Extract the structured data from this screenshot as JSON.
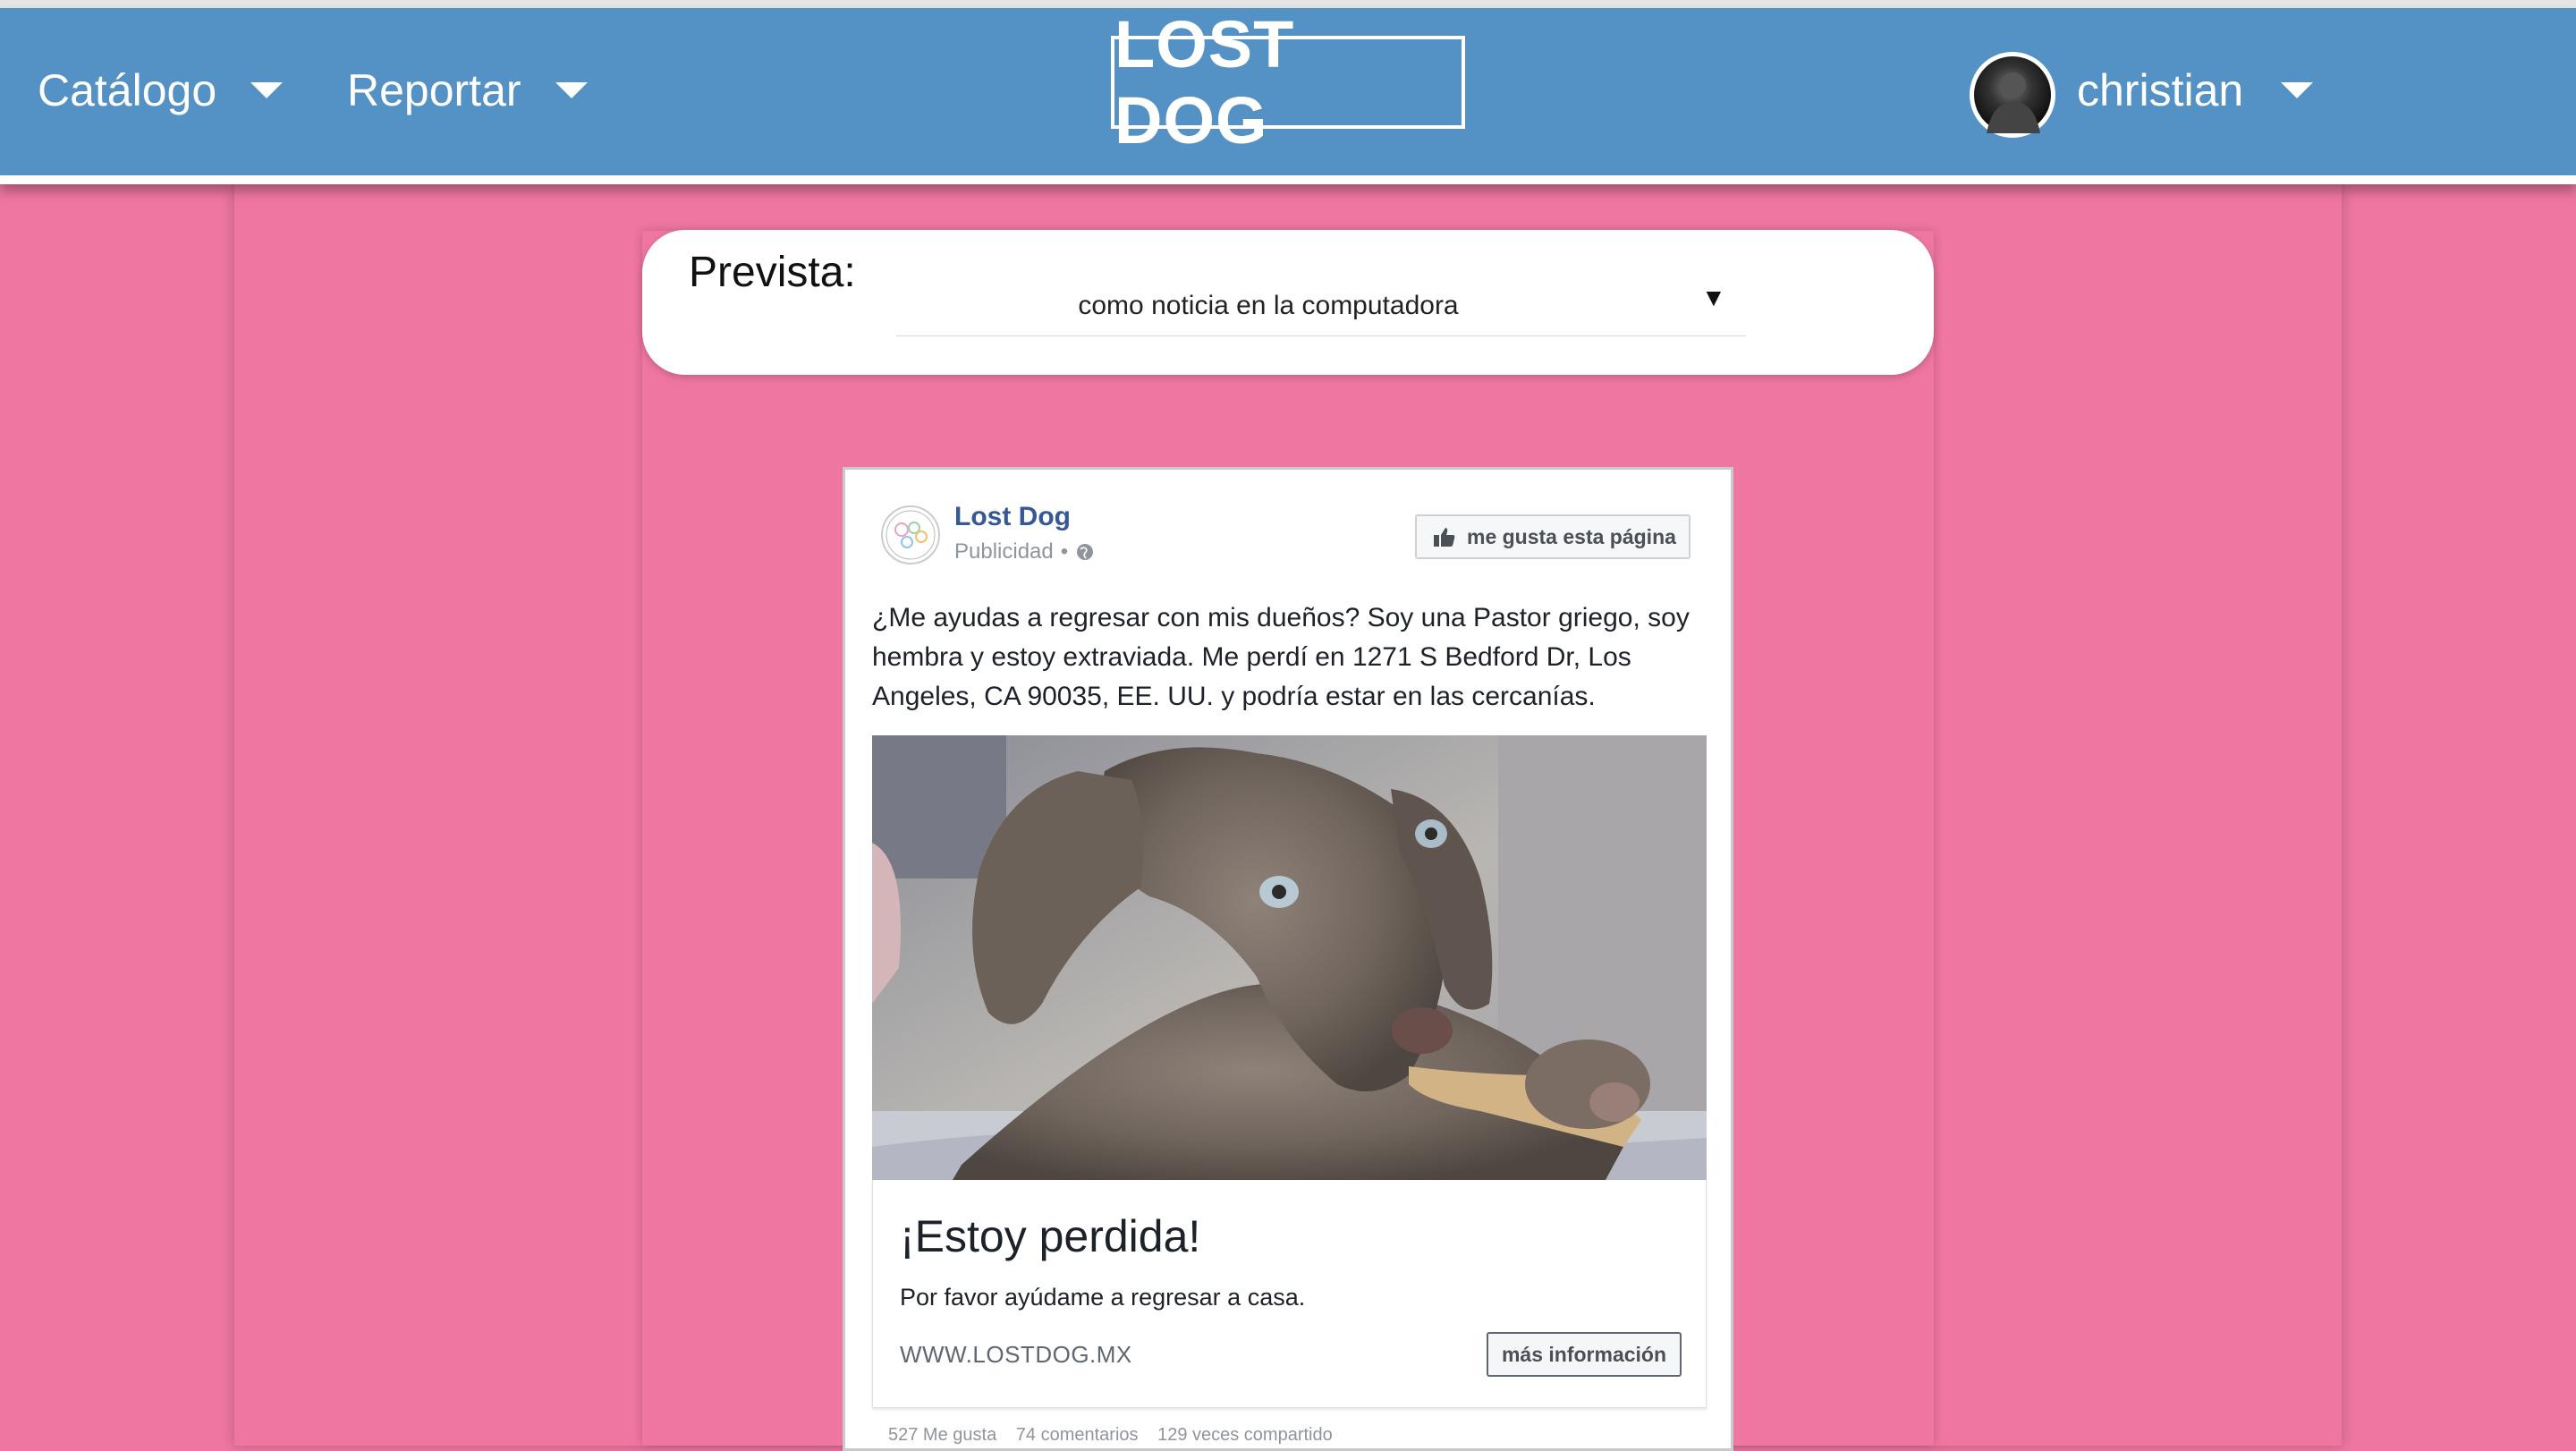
{
  "navbar": {
    "menu_catalog": "Catálogo",
    "menu_report": "Reportar",
    "logo": "LOST DOG",
    "user_name": "christian",
    "background_color": "#5491c5"
  },
  "page": {
    "background_color": "#ee76a0"
  },
  "preview": {
    "label": "Prevista:",
    "selected_option": "como noticia en la computadora",
    "arrow": "▼"
  },
  "ad": {
    "page_name": "Lost Dog",
    "sponsored": "Publicidad",
    "like_page_button": "me gusta esta página",
    "body_text": "¿Me ayudas a regresar con mis dueños? Soy una Pastor griego, soy hembra y estoy extraviada. Me perdí en 1271 S Bedford Dr, Los Angeles, CA 90035, EE. UU. y podría estar en las cercanías.",
    "image_subject": "weimaraner-puppy-photo",
    "headline": "¡Estoy perdida!",
    "description": "Por favor ayúdame a regresar a casa.",
    "domain": "WWW.LOSTDOG.MX",
    "cta_button": "más información",
    "stats": {
      "likes": "527 Me gusta",
      "comments": "74 comentarios",
      "shares": "129 veces compartido"
    }
  }
}
